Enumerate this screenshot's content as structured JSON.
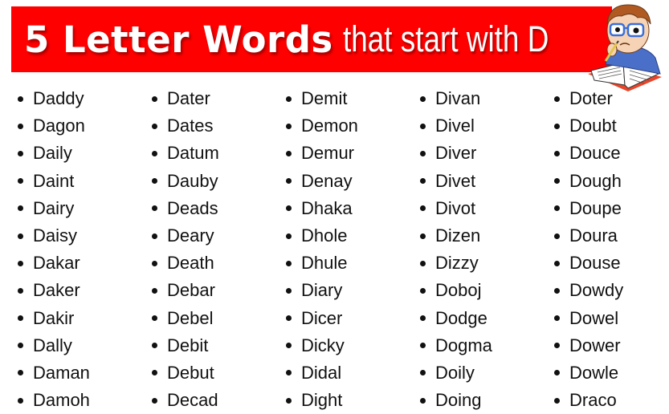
{
  "header": {
    "title_main": "5 Letter Words",
    "title_sub": "that start with D",
    "banner_color": "#ff0000",
    "mascot_icon": "student-reading-book-illustration"
  },
  "word_columns": [
    [
      "Daddy",
      "Dagon",
      "Daily",
      "Daint",
      "Dairy",
      "Daisy",
      "Dakar",
      "Daker",
      "Dakir",
      "Dally",
      "Daman",
      "Damoh"
    ],
    [
      "Dater",
      "Dates",
      "Datum",
      "Dauby",
      "Deads",
      "Deary",
      "Death",
      "Debar",
      "Debel",
      "Debit",
      "Debut",
      "Decad"
    ],
    [
      "Demit",
      "Demon",
      "Demur",
      "Denay",
      "Dhaka",
      "Dhole",
      "Dhule",
      "Diary",
      "Dicer",
      "Dicky",
      "Didal",
      "Dight"
    ],
    [
      "Divan",
      "Divel",
      "Diver",
      "Divet",
      "Divot",
      "Dizen",
      "Dizzy",
      "Doboj",
      "Dodge",
      "Dogma",
      "Doily",
      "Doing"
    ],
    [
      "Doter",
      "Doubt",
      "Douce",
      "Dough",
      "Doupe",
      "Doura",
      "Douse",
      "Dowdy",
      "Dowel",
      "Dower",
      "Dowle",
      "Draco"
    ]
  ]
}
